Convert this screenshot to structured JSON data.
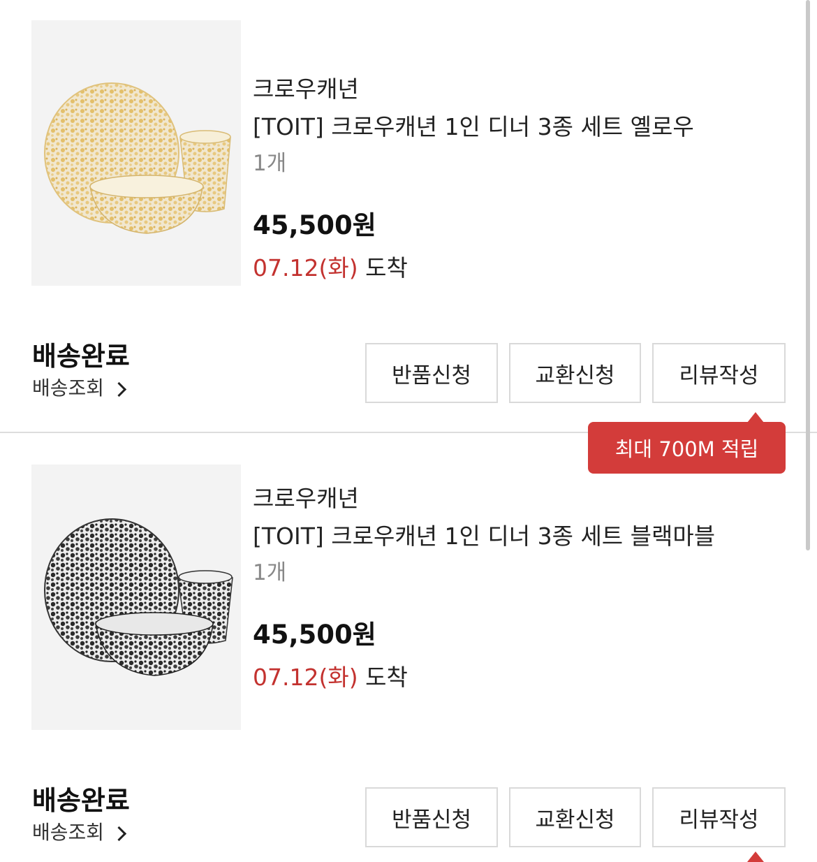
{
  "orders": [
    {
      "brand": "크로우캐년",
      "product_name": "[TOIT] 크로우캐년 1인 디너 3종 세트 옐로우",
      "quantity": "1개",
      "price": "45,500원",
      "arrival_date": "07.12(화)",
      "arrival_suffix": " 도착",
      "status": "배송완료",
      "track_label": "배송조회",
      "buttons": {
        "return": "반품신청",
        "exchange": "교환신청",
        "review": "리뷰작성"
      },
      "image": {
        "icon": "yellow-marble-dinnerware-image",
        "speckle_color": "#e6c67a",
        "base_color": "#f4efe4"
      }
    },
    {
      "brand": "크로우캐년",
      "product_name": "[TOIT] 크로우캐년 1인 디너 3종 세트 블랙마블",
      "quantity": "1개",
      "price": "45,500원",
      "arrival_date": "07.12(화)",
      "arrival_suffix": " 도착",
      "status": "배송완료",
      "track_label": "배송조회",
      "buttons": {
        "return": "반품신청",
        "exchange": "교환신청",
        "review": "리뷰작성"
      },
      "image": {
        "icon": "black-marble-dinnerware-image",
        "speckle_color": "#2b2b2b",
        "base_color": "#f2f2f2"
      }
    }
  ],
  "tooltip": {
    "text": "최대 700M 적립",
    "color": "#d33c3a"
  },
  "accent_color": "#c3322f"
}
